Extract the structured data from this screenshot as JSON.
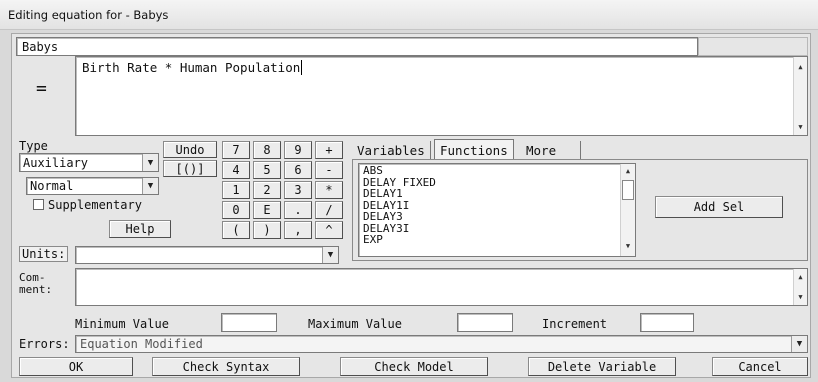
{
  "window": {
    "title": "Editing equation for - Babys"
  },
  "variable_name": "Babys",
  "equals_sign": "=",
  "equation": "Birth Rate * Human Population",
  "type": {
    "label": "Type",
    "selected": "Auxiliary",
    "subtype": "Normal",
    "supplementary_label": "Supplementary",
    "help_label": "Help"
  },
  "keypad": {
    "undo": "Undo",
    "brackets": "[()]",
    "keys": [
      "7",
      "8",
      "9",
      "+",
      "4",
      "5",
      "6",
      "-",
      "1",
      "2",
      "3",
      "*",
      "0",
      "E",
      ".",
      "/",
      "(",
      ")",
      ",",
      "^"
    ]
  },
  "tabs": {
    "variables": "Variables",
    "functions": "Functions",
    "more": "More"
  },
  "functions_list": [
    "ABS",
    "DELAY FIXED",
    "DELAY1",
    "DELAY1I",
    "DELAY3",
    "DELAY3I",
    "EXP"
  ],
  "add_sel": "Add Sel",
  "units": {
    "label": "Units:",
    "value": ""
  },
  "comment": {
    "label_line1": "Com-",
    "label_line2": "ment:",
    "value": ""
  },
  "range": {
    "min_label": "Minimum Value",
    "max_label": "Maximum Value",
    "inc_label": "Increment"
  },
  "errors": {
    "label": "Errors:",
    "value": "Equation Modified"
  },
  "buttons": {
    "ok": "OK",
    "check_syntax": "Check Syntax",
    "check_model": "Check Model",
    "delete_variable": "Delete Variable",
    "cancel": "Cancel"
  },
  "icons": {
    "dropdown": "chevron-down-icon",
    "scroll_up": "arrow-up-icon",
    "scroll_down": "arrow-down-icon"
  }
}
